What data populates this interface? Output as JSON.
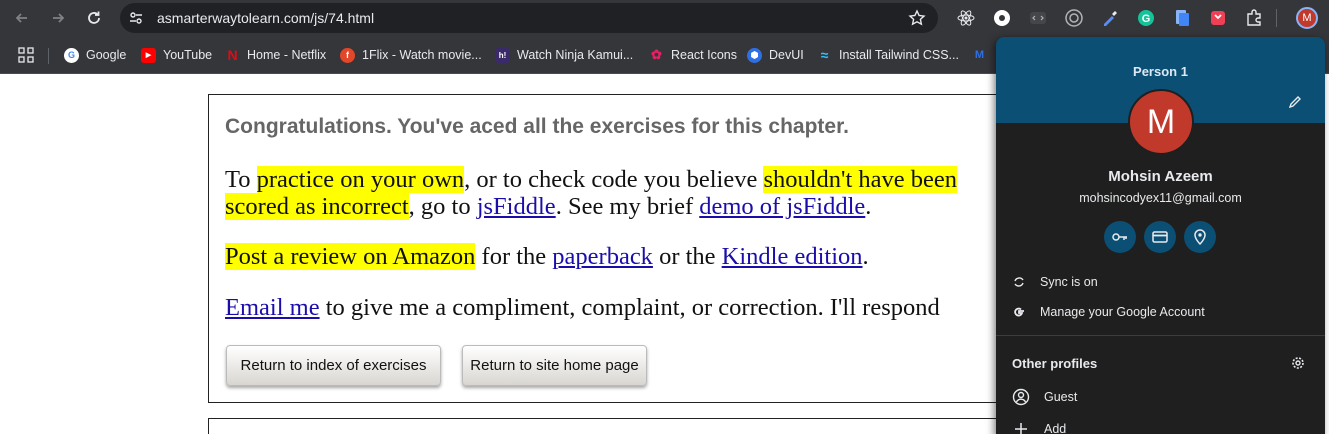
{
  "browser": {
    "url": "asmarterwaytolearn.com/js/74.html",
    "bookmarks": [
      {
        "label": "Google",
        "color": "#ffffff",
        "glyph": "G"
      },
      {
        "label": "YouTube",
        "color": "#ff0000",
        "glyph": "▶"
      },
      {
        "label": "Home - Netflix",
        "color": "#e50914",
        "glyph": "N"
      },
      {
        "label": "1Flix - Watch movie...",
        "color": "#e2472a",
        "glyph": "f"
      },
      {
        "label": "Watch Ninja Kamui...",
        "color": "#3a2a6a",
        "glyph": "h!"
      },
      {
        "label": "React Icons",
        "color": "#e91e63",
        "glyph": "✿"
      },
      {
        "label": "DevUI",
        "color": "#2f6fe4",
        "glyph": "⬢"
      },
      {
        "label": "Install Tailwind CSS...",
        "color": "#38bdf8",
        "glyph": "≈"
      }
    ]
  },
  "page": {
    "congrats": "Congratulations. You've aced all the exercises for this chapter.",
    "practice": {
      "pre": "To ",
      "hl1": "practice on your own",
      "mid1": ", or to check code you believe ",
      "hl2": "shouldn't have been",
      "line2_hl": "scored as incorrect",
      "line2_mid": ", go to ",
      "link1": "jsFiddle",
      "line2_mid2": ". See my brief ",
      "link2": "demo of jsFiddle",
      "line2_end": "."
    },
    "review": {
      "hl": "Post a review on Amazon",
      "mid1": " for the ",
      "link1": "paperback",
      "mid2": " or the ",
      "link2": "Kindle edition",
      "end": "."
    },
    "email": {
      "link": "Email me",
      "rest": " to give me a compliment, complaint, or correction. I'll respond"
    },
    "buttons": {
      "index": "Return to index of exercises",
      "home": "Return to site home page"
    }
  },
  "profile_popup": {
    "person_label": "Person 1",
    "avatar_letter": "M",
    "name": "Mohsin Azeem",
    "email": "mohsincodyex11@gmail.com",
    "sync": "Sync is on",
    "manage": "Manage your Google Account",
    "other_profiles": "Other profiles",
    "guest": "Guest",
    "add": "Add"
  },
  "colors": {
    "highlight": "#ffff00",
    "link": "#1a0dab",
    "popup_header": "#0b4f74",
    "avatar": "#c0392b"
  }
}
